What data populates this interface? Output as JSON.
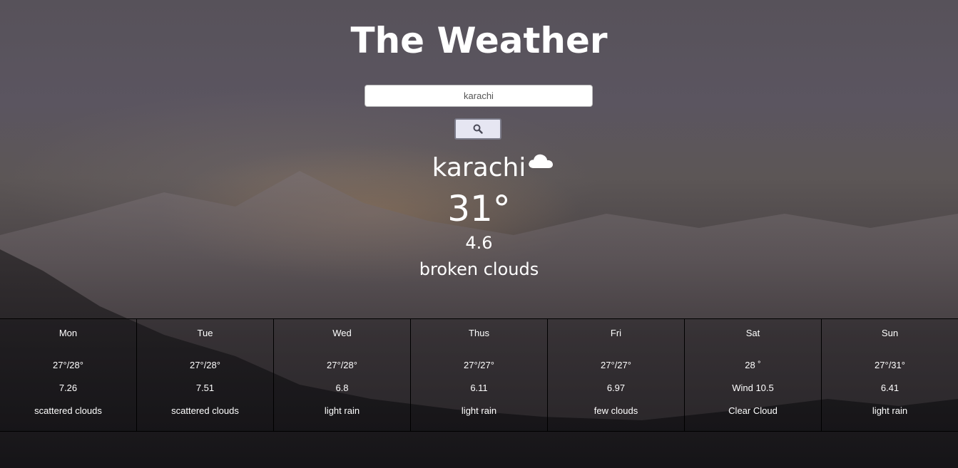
{
  "header": {
    "title": "The Weather"
  },
  "search": {
    "value": "karachi",
    "button_icon": "search-icon"
  },
  "current": {
    "city": "karachi",
    "icon": "cloud-icon",
    "temperature": "31°",
    "wind": "4.6",
    "description": "broken clouds"
  },
  "forecast": [
    {
      "day": "Mon",
      "temp": "27°/28°",
      "wind": "7.26",
      "desc": "scattered clouds"
    },
    {
      "day": "Tue",
      "temp": "27°/28°",
      "wind": "7.51",
      "desc": "scattered clouds"
    },
    {
      "day": "Wed",
      "temp": "27°/28°",
      "wind": "6.8",
      "desc": "light rain"
    },
    {
      "day": "Thus",
      "temp": "27°/27°",
      "wind": "6.11",
      "desc": "light rain"
    },
    {
      "day": "Fri",
      "temp": "27°/27°",
      "wind": "6.97",
      "desc": "few clouds"
    },
    {
      "day": "Sat",
      "temp": "28 ˚",
      "wind": "Wind 10.5",
      "desc": "Clear Cloud"
    },
    {
      "day": "Sun",
      "temp": "27°/31°",
      "wind": "6.41",
      "desc": "light rain"
    }
  ]
}
